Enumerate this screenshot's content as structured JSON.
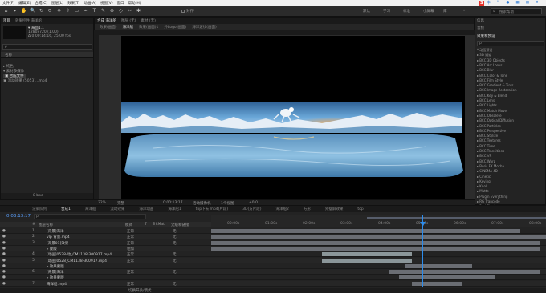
{
  "menubar": {
    "items": [
      "文件(F)",
      "编辑(E)",
      "合成(C)",
      "图层(L)",
      "效果(T)",
      "动画(A)",
      "视图(V)",
      "窗口",
      "帮助(H)"
    ],
    "right_icons": [
      "brand-s-icon",
      "english-toggle-icon",
      "punctuation-icon",
      "microphone-icon",
      "keyboard-icon",
      "grid-icon",
      "shirt-icon"
    ],
    "brand_char": "S",
    "lang_char": "中"
  },
  "toolbar": {
    "tools": [
      "home",
      "selection",
      "hand",
      "zoom",
      "rotate",
      "orbit",
      "pan",
      "dolly",
      "rect-mask",
      "pen",
      "text",
      "brush",
      "clone",
      "eraser",
      "roto",
      "puppet"
    ],
    "glyphs": [
      "⌂",
      "▸",
      "✋",
      "🔍",
      "↻",
      "⟳",
      "✥",
      "⇳",
      "▭",
      "✒",
      "T",
      "✎",
      "⊕",
      "◇",
      "✂",
      "✱"
    ],
    "align_label": "对齐",
    "workspaces": [
      "默认",
      "学习",
      "标准",
      "小屏幕",
      "库",
      "»"
    ],
    "search_placeholder": "搜索帮助"
  },
  "project_panel": {
    "tabs": [
      "项目",
      "效果控件 海洋船"
    ],
    "selected_name": "▾ 海面1.1",
    "selected_info": [
      "1280x720 (1.00)",
      "Δ 0:00:14:16, 25.00 fps"
    ],
    "search_placeholder": "ρ",
    "column_name": "名称",
    "items": [
      "▸ 纯色",
      "▾ 素材多媒体",
      "  ▣ 合成文件",
      "▣ 流动效果 (5053)...mp4"
    ],
    "bottom": {
      "bpc": "8 bpc"
    }
  },
  "viewer": {
    "tabs": [
      "合成 海洋船",
      "图层 (无)",
      "素材 (无)"
    ],
    "sub_tabs": [
      "效果(画面)",
      "海洋船",
      "效果(画面)1",
      "外Logo(画面)",
      "海洋波纹(画面)"
    ],
    "zoom": "22%",
    "quality": "完整",
    "timecode": "0:00:13:17",
    "camera": "活动摄像机",
    "views": "1个视图",
    "offset": "+0.0"
  },
  "effects_panel": {
    "tabs": [
      "信息",
      "音频",
      "效果和预设"
    ],
    "search_placeholder": "ρ",
    "items": [
      "* 动画预设",
      "▸ 3D 通道",
      "▸ BCC 3D Objects",
      "▸ BCC Art Looks",
      "▸ BCC Blur",
      "▸ BCC Color & Tone",
      "▸ BCC Film Style",
      "▸ BCC Gradient & Tints",
      "▸ BCC Image Restoration",
      "▸ BCC Key & Blend",
      "▸ BCC Lens",
      "▸ BCC Lights",
      "▸ BCC Match Move",
      "▸ BCC Obsolete",
      "▸ BCC Optical Diffusion",
      "▸ BCC Particles",
      "▸ BCC Perspective",
      "▸ BCC Stylize",
      "▸ BCC Textures",
      "▸ BCC Time",
      "▸ BCC Transitions",
      "▸ BCC VR",
      "▸ BCC Warp",
      "▸ Boris FX Mocha",
      "▸ CINEMA 4D",
      "▸ Cinetic",
      "▸ Keying",
      "▸ Knoll",
      "▸ Matte",
      "▸ Plugin Everything",
      "▸ RG Trapcode",
      "▸ Red Giant"
    ]
  },
  "timeline": {
    "tabs": [
      "渲染队列",
      "合成1",
      "海洋船",
      "流动效果",
      "海洋动画",
      "海洋船1",
      "top下去 mp4(片段)",
      "3D(方片段)",
      "海洋船2",
      "方形",
      "外摆屏效果",
      "top"
    ],
    "timecode": "0:03:13:17",
    "columns": [
      "#",
      "图层名称",
      "模式",
      "T",
      "TrkMat",
      "父级和链接"
    ],
    "ticks": [
      "00:00s",
      "01:00s",
      "02:00s",
      "03:00s",
      "04:00s",
      "05:00s",
      "06:00s",
      "07:00s",
      "08:00s"
    ],
    "layers": [
      {
        "num": "1",
        "name": "[背景]海洋",
        "mode": "正常",
        "parent": "无",
        "color": "#6a6a6a"
      },
      {
        "num": "2",
        "name": "vlp 背景.mp4",
        "mode": "正常",
        "parent": "无",
        "color": "#6a6a6a"
      },
      {
        "num": "3",
        "name": "[海景01]效果",
        "mode": "正常",
        "parent": "无",
        "color": "#6a6a6a"
      },
      {
        "num": "",
        "name": "▸ 蒙版",
        "mode": "相加",
        "parent": "",
        "color": "#6a6a6a"
      },
      {
        "num": "4",
        "name": "[动画]0528-动_CM1138-300917.mp4",
        "mode": "正常",
        "parent": "无",
        "color": "#6a6a6a"
      },
      {
        "num": "5",
        "name": "[动画]0528_CM1138-300917.mp4",
        "mode": "正常",
        "parent": "无",
        "color": "#6a6a6a"
      },
      {
        "num": "",
        "name": "▸ 效果蒙版",
        "mode": "",
        "parent": "",
        "color": "#6a6a6a"
      },
      {
        "num": "6",
        "name": "[背景]海洋",
        "mode": "正常",
        "parent": "无",
        "color": "#6a6a6a"
      },
      {
        "num": "",
        "name": "▸ 效果蒙版",
        "mode": "",
        "parent": "",
        "color": "#6a6a6a"
      },
      {
        "num": "7",
        "name": "海洋船.mp4",
        "mode": "正常",
        "parent": "无",
        "color": "#6a6a6a"
      }
    ],
    "bottom": "切换开关/模式"
  },
  "colors": {
    "accent": "#2d8ceb",
    "panel": "#232323",
    "bg": "#1d1d1d"
  }
}
